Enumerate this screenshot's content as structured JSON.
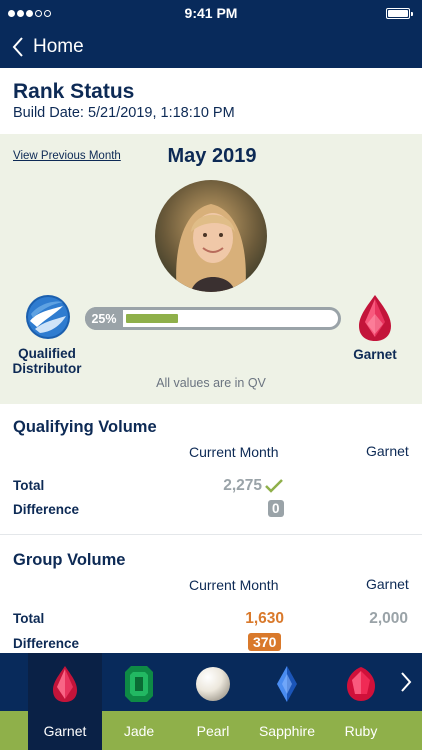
{
  "status_bar": {
    "time": "9:41 PM"
  },
  "nav": {
    "back_label": "Home"
  },
  "header": {
    "title": "Rank Status",
    "build_date": "Build Date: 5/21/2019, 1:18:10 PM"
  },
  "hero": {
    "prev_link": "View Previous Month",
    "month": "May 2019",
    "current_rank": "Qualified Distributor",
    "next_rank": "Garnet",
    "progress_label": "25%",
    "progress_fraction": 0.25,
    "note": "All values are in QV"
  },
  "qualifying_volume": {
    "title": "Qualifying Volume",
    "col_current": "Current Month",
    "col_target": "Garnet",
    "total_label": "Total",
    "total_value": "2,275",
    "difference_label": "Difference",
    "difference_value": "0"
  },
  "group_volume": {
    "title": "Group Volume",
    "col_current": "Current Month",
    "col_target": "Garnet",
    "total_label": "Total",
    "total_value": "1,630",
    "target_value": "2,000",
    "difference_label": "Difference",
    "difference_value": "370"
  },
  "tabs": [
    {
      "label": "Garnet",
      "icon": "garnet-gem-icon"
    },
    {
      "label": "Jade",
      "icon": "jade-gem-icon"
    },
    {
      "label": "Pearl",
      "icon": "pearl-gem-icon"
    },
    {
      "label": "Sapphire",
      "icon": "sapphire-gem-icon"
    },
    {
      "label": "Ruby",
      "icon": "ruby-gem-icon"
    }
  ],
  "colors": {
    "navy": "#082a5b",
    "green": "#8fb04a",
    "orange": "#d9792b",
    "gray": "#9aa3a8",
    "hero_bg": "#eef2e6"
  }
}
